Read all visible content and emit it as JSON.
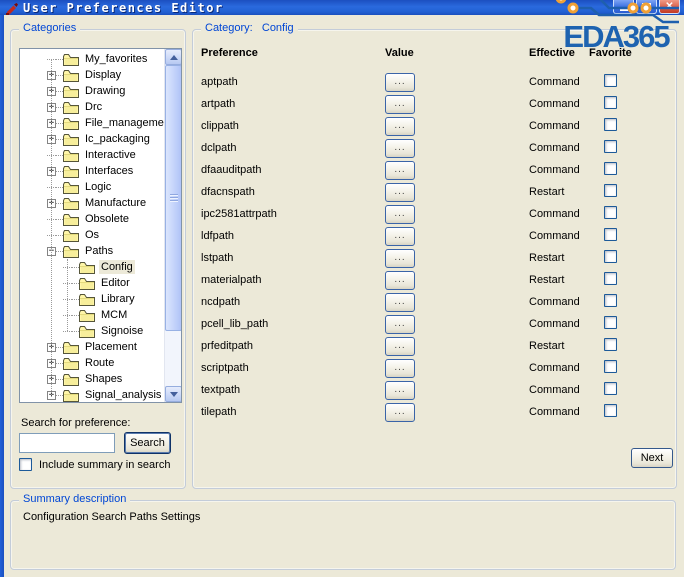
{
  "window": {
    "title": "User Preferences Editor",
    "controls": {
      "minimize": "minimize",
      "maximize": "maximize",
      "close": "close"
    }
  },
  "logo": {
    "text": "EDA365"
  },
  "colors": {
    "titlebar_blue": "#2a6ade",
    "group_label_blue": "#0046d5",
    "dialog_bg": "#ece9d8",
    "logo_blue": "#1e63b0",
    "logo_orange": "#f0a136",
    "selection_bg": "#ece9d8",
    "close_red": "#d9604a"
  },
  "categories_panel": {
    "group_label": "Categories",
    "tree": [
      {
        "label": "My_favorites",
        "level": 1,
        "expander": "none"
      },
      {
        "label": "Display",
        "level": 1,
        "expander": "plus"
      },
      {
        "label": "Drawing",
        "level": 1,
        "expander": "plus"
      },
      {
        "label": "Drc",
        "level": 1,
        "expander": "plus"
      },
      {
        "label": "File_management",
        "level": 1,
        "expander": "plus"
      },
      {
        "label": "Ic_packaging",
        "level": 1,
        "expander": "plus"
      },
      {
        "label": "Interactive",
        "level": 1,
        "expander": "none"
      },
      {
        "label": "Interfaces",
        "level": 1,
        "expander": "plus"
      },
      {
        "label": "Logic",
        "level": 1,
        "expander": "none"
      },
      {
        "label": "Manufacture",
        "level": 1,
        "expander": "plus"
      },
      {
        "label": "Obsolete",
        "level": 1,
        "expander": "none"
      },
      {
        "label": "Os",
        "level": 1,
        "expander": "none"
      },
      {
        "label": "Paths",
        "level": 1,
        "expander": "minus"
      },
      {
        "label": "Config",
        "level": 2,
        "expander": "none",
        "selected": true
      },
      {
        "label": "Editor",
        "level": 2,
        "expander": "none"
      },
      {
        "label": "Library",
        "level": 2,
        "expander": "none"
      },
      {
        "label": "MCM",
        "level": 2,
        "expander": "none"
      },
      {
        "label": "Signoise",
        "level": 2,
        "expander": "none"
      },
      {
        "label": "Placement",
        "level": 1,
        "expander": "plus"
      },
      {
        "label": "Route",
        "level": 1,
        "expander": "plus"
      },
      {
        "label": "Shapes",
        "level": 1,
        "expander": "plus"
      },
      {
        "label": "Signal_analysis",
        "level": 1,
        "expander": "plus"
      }
    ],
    "search": {
      "label": "Search for preference:",
      "value": "",
      "button": "Search",
      "include_label": "Include summary in search",
      "include_checked": false
    }
  },
  "category_panel": {
    "group_label": "Category:",
    "category_name": "Config",
    "headers": {
      "preference": "Preference",
      "value": "Value",
      "effective": "Effective",
      "favorite": "Favorite"
    },
    "value_button": "...",
    "next_button": "Next",
    "rows": [
      {
        "preference": "aptpath",
        "effective": "Command",
        "favorite": false
      },
      {
        "preference": "artpath",
        "effective": "Command",
        "favorite": false
      },
      {
        "preference": "clippath",
        "effective": "Command",
        "favorite": false
      },
      {
        "preference": "dclpath",
        "effective": "Command",
        "favorite": false
      },
      {
        "preference": "dfaauditpath",
        "effective": "Command",
        "favorite": false
      },
      {
        "preference": "dfacnspath",
        "effective": "Restart",
        "favorite": false
      },
      {
        "preference": "ipc2581attrpath",
        "effective": "Command",
        "favorite": false
      },
      {
        "preference": "ldfpath",
        "effective": "Command",
        "favorite": false
      },
      {
        "preference": "lstpath",
        "effective": "Restart",
        "favorite": false
      },
      {
        "preference": "materialpath",
        "effective": "Restart",
        "favorite": false
      },
      {
        "preference": "ncdpath",
        "effective": "Command",
        "favorite": false
      },
      {
        "preference": "pcell_lib_path",
        "effective": "Command",
        "favorite": false
      },
      {
        "preference": "prfeditpath",
        "effective": "Restart",
        "favorite": false
      },
      {
        "preference": "scriptpath",
        "effective": "Command",
        "favorite": false
      },
      {
        "preference": "textpath",
        "effective": "Command",
        "favorite": false
      },
      {
        "preference": "tilepath",
        "effective": "Command",
        "favorite": false
      }
    ]
  },
  "summary_panel": {
    "group_label": "Summary description",
    "text": "Configuration Search Paths Settings"
  }
}
